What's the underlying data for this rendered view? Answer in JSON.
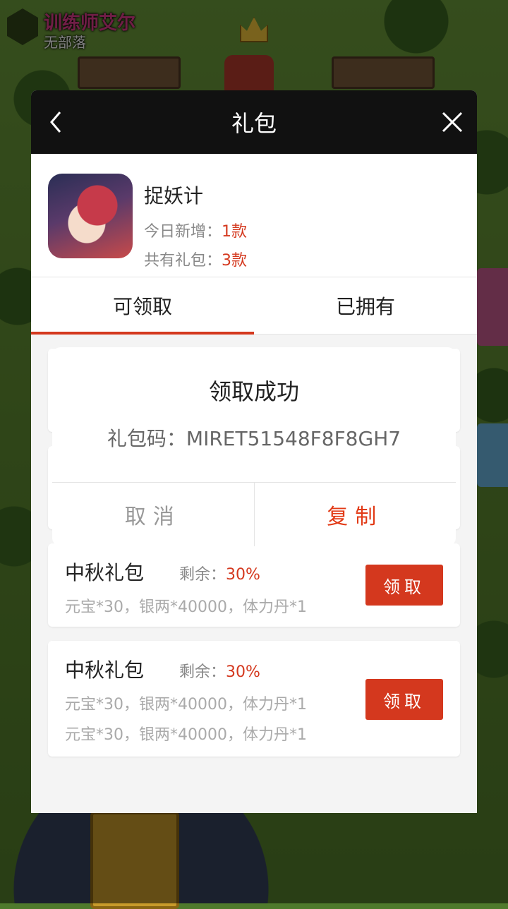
{
  "game_hud": {
    "player_name": "训练师艾尔",
    "clan": "无部落",
    "crown_count": "1"
  },
  "panel": {
    "title": "礼包",
    "back_icon": "chevron-left-icon",
    "close_icon": "close-icon"
  },
  "game": {
    "name": "捉妖计",
    "new_today_label": "今日新增：",
    "new_today_value": "1款",
    "total_label": "共有礼包：",
    "total_value": "3款"
  },
  "tabs": [
    {
      "label": "可领取",
      "active": true
    },
    {
      "label": "已拥有",
      "active": false
    }
  ],
  "gifts": [
    {
      "title": "中秋礼包",
      "remain_label": "剩余：",
      "remain_value": "30%",
      "lines": [
        "元宝*30，银两*40000，体力丹*1"
      ],
      "button": "领取"
    },
    {
      "title": "中秋礼包",
      "remain_label": "剩余：",
      "remain_value": "30%",
      "lines": [
        "元宝*30，银两*40000，体力丹*1",
        "元宝*30，银两*40000，体力丹*1"
      ],
      "button": "领取"
    }
  ],
  "dialog": {
    "title": "领取成功",
    "code_label": "礼包码：",
    "code_value": "MIRET51548F8F8GH7",
    "cancel": "取消",
    "copy": "复制"
  },
  "colors": {
    "accent": "#d4381e",
    "header_bg": "#111111"
  }
}
